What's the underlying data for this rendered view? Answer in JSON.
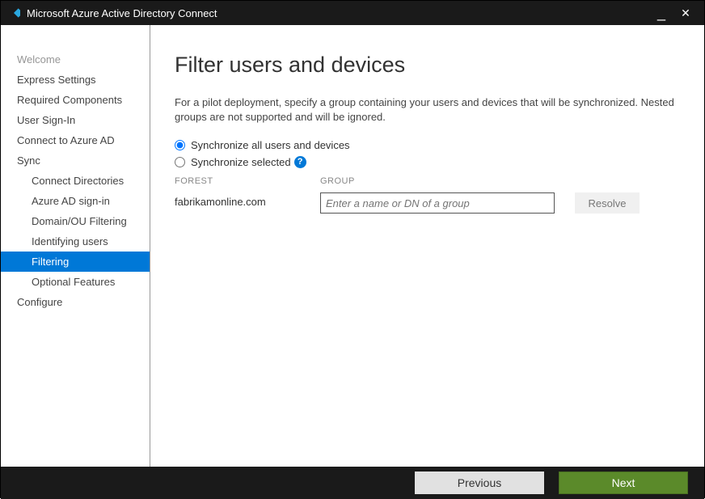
{
  "window": {
    "title": "Microsoft Azure Active Directory Connect"
  },
  "nav": {
    "welcome": "Welcome",
    "express": "Express Settings",
    "required": "Required Components",
    "signin": "User Sign-In",
    "connect": "Connect to Azure AD",
    "sync": "Sync",
    "sync_items": {
      "dirs": "Connect Directories",
      "aad_signin": "Azure AD sign-in",
      "domain_ou": "Domain/OU Filtering",
      "identifying": "Identifying users",
      "filtering": "Filtering",
      "optional": "Optional Features"
    },
    "configure": "Configure"
  },
  "page": {
    "title": "Filter users and devices",
    "description": "For a pilot deployment, specify a group containing your users and devices that will be synchronized. Nested groups are not supported and will be ignored.",
    "radio_all": "Synchronize all users and devices",
    "radio_selected": "Synchronize selected",
    "col_forest": "FOREST",
    "col_group": "GROUP",
    "forest_value": "fabrikamonline.com",
    "group_placeholder": "Enter a name or DN of a group",
    "resolve": "Resolve"
  },
  "footer": {
    "previous": "Previous",
    "next": "Next"
  }
}
